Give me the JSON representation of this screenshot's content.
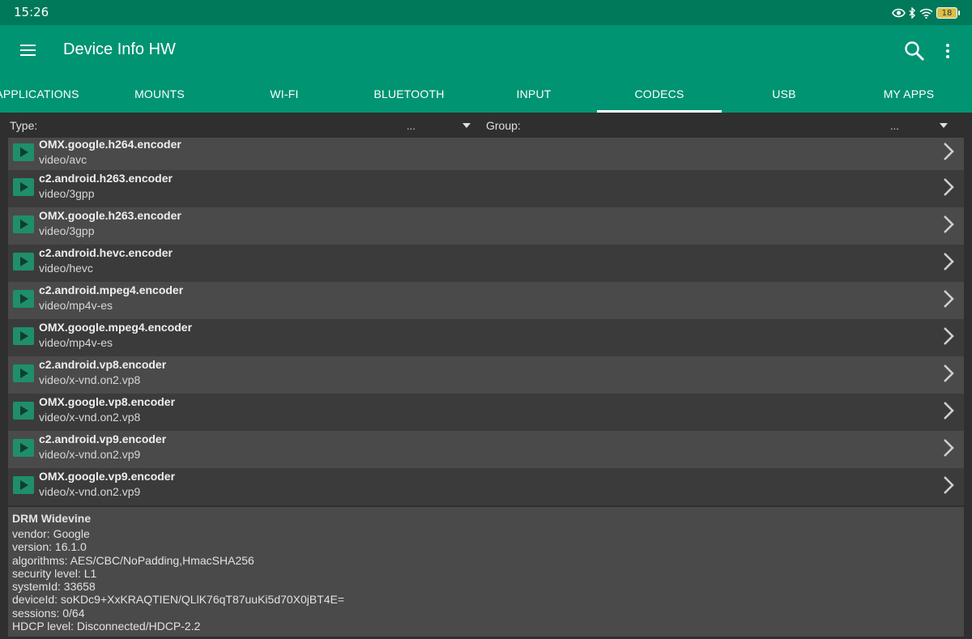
{
  "status_bar": {
    "time": "15:26",
    "battery": "18"
  },
  "toolbar": {
    "title": "Device Info HW"
  },
  "tabs": [
    {
      "label": "APPLICATIONS"
    },
    {
      "label": "MOUNTS"
    },
    {
      "label": "WI-FI"
    },
    {
      "label": "BLUETOOTH"
    },
    {
      "label": "INPUT"
    },
    {
      "label": "CODECS",
      "active": true
    },
    {
      "label": "USB"
    },
    {
      "label": "MY APPS"
    }
  ],
  "filters": {
    "type_label": "Type:",
    "type_value": "...",
    "group_label": "Group:",
    "group_value": "..."
  },
  "codecs": [
    {
      "name": "OMX.google.h264.encoder",
      "mime": "video/avc"
    },
    {
      "name": "c2.android.h263.encoder",
      "mime": "video/3gpp"
    },
    {
      "name": "OMX.google.h263.encoder",
      "mime": "video/3gpp"
    },
    {
      "name": "c2.android.hevc.encoder",
      "mime": "video/hevc"
    },
    {
      "name": "c2.android.mpeg4.encoder",
      "mime": "video/mp4v-es"
    },
    {
      "name": "OMX.google.mpeg4.encoder",
      "mime": "video/mp4v-es"
    },
    {
      "name": "c2.android.vp8.encoder",
      "mime": "video/x-vnd.on2.vp8"
    },
    {
      "name": "OMX.google.vp8.encoder",
      "mime": "video/x-vnd.on2.vp8"
    },
    {
      "name": "c2.android.vp9.encoder",
      "mime": "video/x-vnd.on2.vp9"
    },
    {
      "name": "OMX.google.vp9.encoder",
      "mime": "video/x-vnd.on2.vp9"
    }
  ],
  "drm": {
    "title": "DRM Widevine",
    "lines": [
      "vendor: Google",
      "version: 16.1.0",
      "algorithms: AES/CBC/NoPadding,HmacSHA256",
      "security level: L1",
      "systemId: 33658",
      "deviceId: soKDc9+XxKRAQTIEN/QLlK76qT87uuKi5d70X0jBT4E=",
      "sessions: 0/64",
      "HDCP level: Disconnected/HDCP-2.2"
    ]
  },
  "colors": {
    "status_bar": "#00795a",
    "toolbar": "#009473",
    "play_icon": "#1f8e6b",
    "background": "#2f2f2f"
  }
}
